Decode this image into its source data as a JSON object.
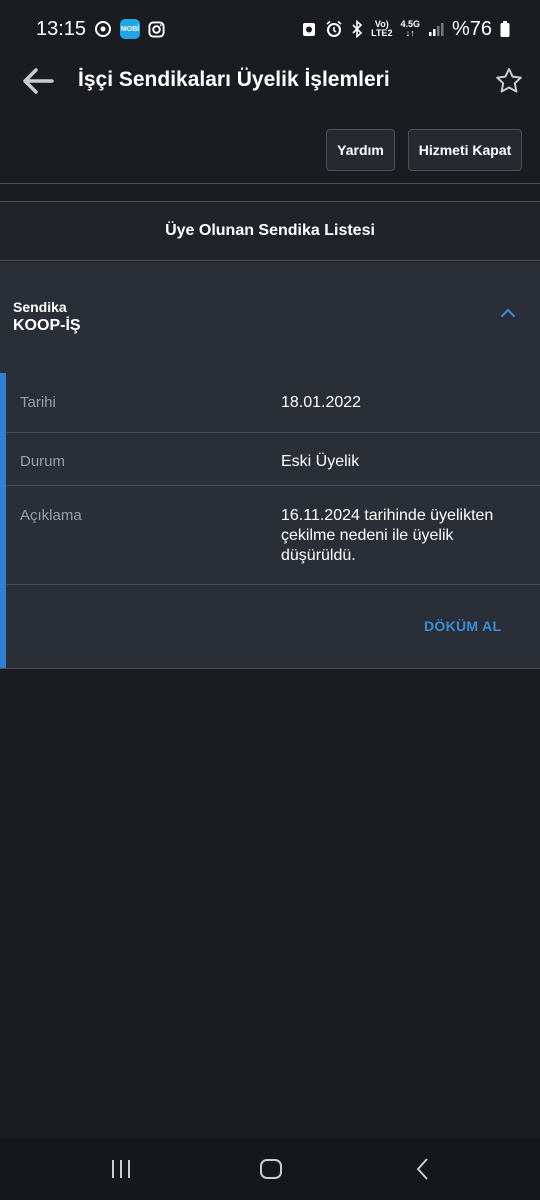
{
  "status_bar": {
    "time": "13:15",
    "app_badge_label": "MOBİ",
    "network_top": "Vo)",
    "network_bottom": "LTE2",
    "data_type": "4.5G",
    "battery": "%76",
    "icons": [
      "data-saver-icon",
      "app-badge-icon",
      "instagram-icon",
      "alarm-clock-icon",
      "bluetooth-icon",
      "signal-icon",
      "battery-icon"
    ]
  },
  "app_bar": {
    "title": "İşçi Sendikaları Üyelik İşlemleri",
    "back_icon": "arrow-left-icon",
    "favorite_icon": "star-outline-icon"
  },
  "toolbar": {
    "help_label": "Yardım",
    "close_service_label": "Hizmeti Kapat"
  },
  "section": {
    "title": "Üye Olunan Sendika Listesi"
  },
  "card": {
    "label": "Sendika",
    "value": "KOOP-İŞ",
    "rows": [
      {
        "label": "Tarihi",
        "value": "18.01.2022"
      },
      {
        "label": "Durum",
        "value": "Eski Üyelik"
      },
      {
        "label": "Açıklama",
        "value": "16.11.2024 tarihinde üyelikten çekilme nedeni ile üyelik düşürüldü."
      }
    ],
    "action_label": "DÖKÜM AL"
  },
  "colors": {
    "background": "#1b1c20",
    "panel": "#2a2e36",
    "accent": "#2e82d3",
    "link": "#3b8ed8"
  }
}
